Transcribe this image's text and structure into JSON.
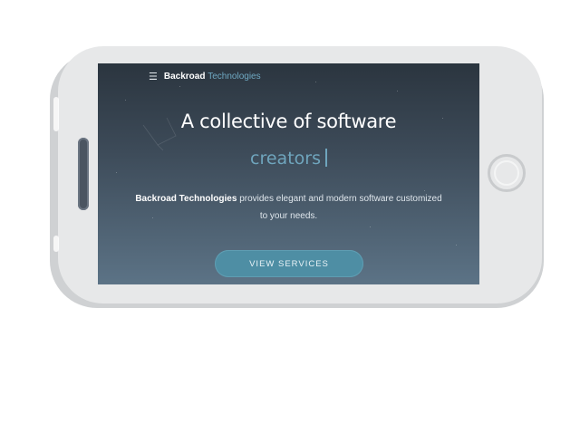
{
  "navbar": {
    "menu_icon": "hamburger-menu-icon",
    "brand_primary": "Backroad",
    "brand_accent": "Technologies"
  },
  "hero": {
    "headline": "A collective of software",
    "typed_word": "creators",
    "tagline_brand": "Backroad Technologies",
    "tagline_rest": "provides elegant and modern software customized to your needs.",
    "cta_label": "VIEW SERVICES"
  },
  "colors": {
    "accent": "#6fa8c2",
    "button": "#4e8ea4",
    "screen_top": "#2b353f",
    "screen_bottom": "#5c7386",
    "phone_body": "#e7e8e9"
  }
}
